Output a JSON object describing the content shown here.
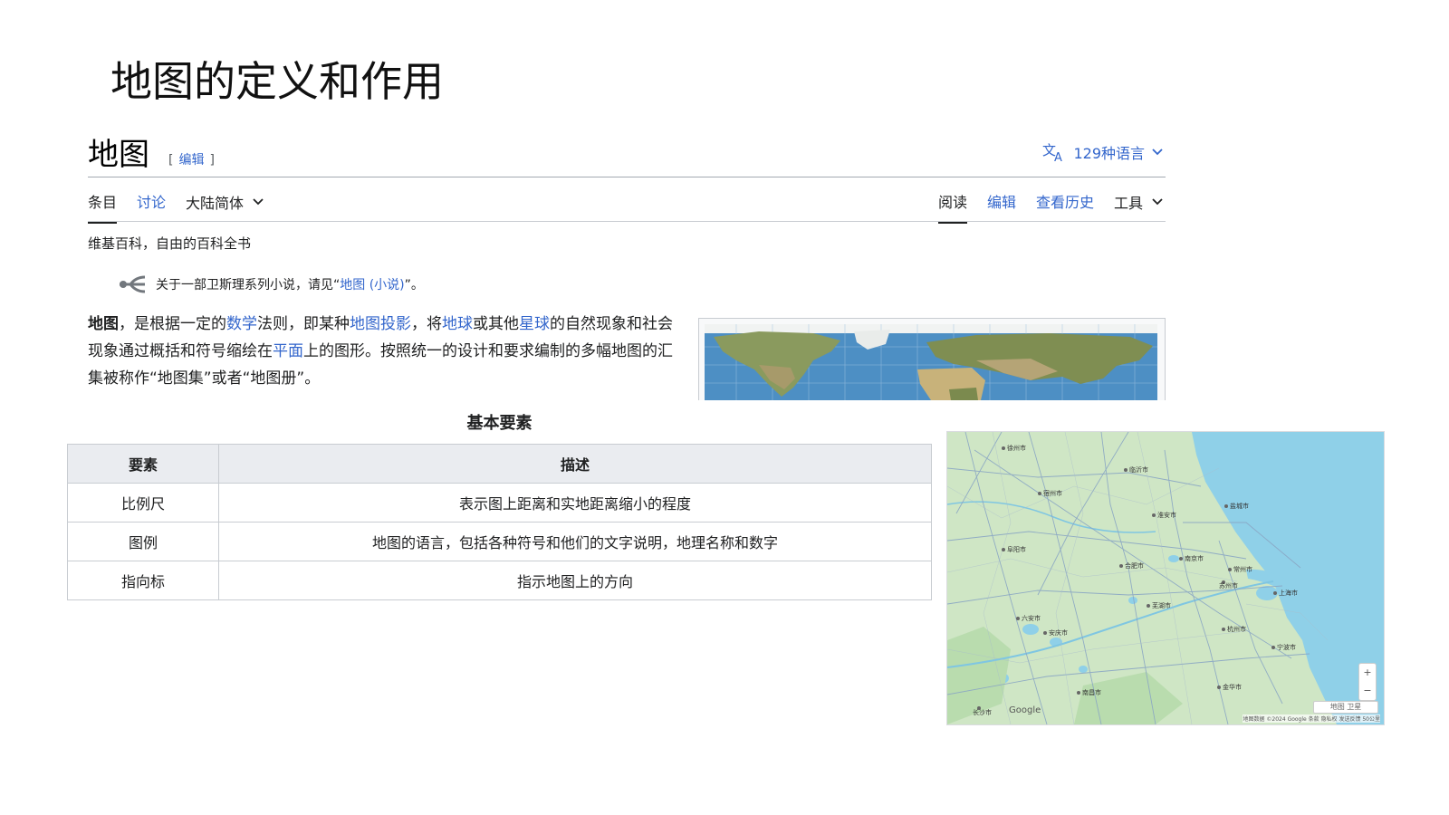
{
  "slide_title": "地图的定义和作用",
  "wiki": {
    "title": "地图",
    "edit_bracket_open": "[",
    "edit_label": "编辑",
    "edit_bracket_close": "]",
    "languages_label": "129种语言",
    "tabs_left": [
      {
        "label": "条目",
        "active": true
      },
      {
        "label": "讨论",
        "active": false
      },
      {
        "label": "大陆简体",
        "active": false
      }
    ],
    "tabs_right": [
      {
        "label": "阅读",
        "active": true
      },
      {
        "label": "编辑",
        "active": false
      },
      {
        "label": "查看历史",
        "active": false
      },
      {
        "label": "工具",
        "active": false
      }
    ],
    "tagline": "维基百科，自由的百科全书",
    "hatnote": {
      "prefix": "关于一部卫斯理系列小说，请见“",
      "link": "地图 (小说)",
      "suffix": "”。"
    },
    "paragraph": {
      "bold": "地图",
      "t1": "，是根据一定的",
      "l1": "数学",
      "t2": "法则，即某种",
      "l2": "地图投影",
      "t3": "，将",
      "l3": "地球",
      "t4": "或其他",
      "l4": "星球",
      "t5": "的自然现象和社会现象通过概括和符号缩绘在",
      "l5": "平面",
      "t6": "上的图形。按照统一的设计和要求编制的多幅地图的汇集被称作“地图集”或者“地图册”。"
    }
  },
  "table": {
    "caption": "基本要素",
    "headers": [
      "要素",
      "描述"
    ],
    "rows": [
      [
        "比例尺",
        "表示图上距离和实地距离缩小的程度"
      ],
      [
        "图例",
        "地图的语言，包括各种符号和他们的文字说明，地理名称和数字"
      ],
      [
        "指向标",
        "指示地图上的方向"
      ]
    ]
  },
  "gmap": {
    "logo": "Google",
    "zoom_in": "+",
    "zoom_out": "−",
    "footer": "地图数据 ©2024 Google  条款  隐私权  发送反馈  50公里",
    "layer_label": "地图 卫星"
  },
  "colors": {
    "link": "#3366cc",
    "land": "#cfe6c5",
    "water": "#8fd0e8",
    "ocean": "#4d8fc4"
  },
  "icons": [
    "translate-icon",
    "chevron-down-icon",
    "disambiguation-icon"
  ]
}
